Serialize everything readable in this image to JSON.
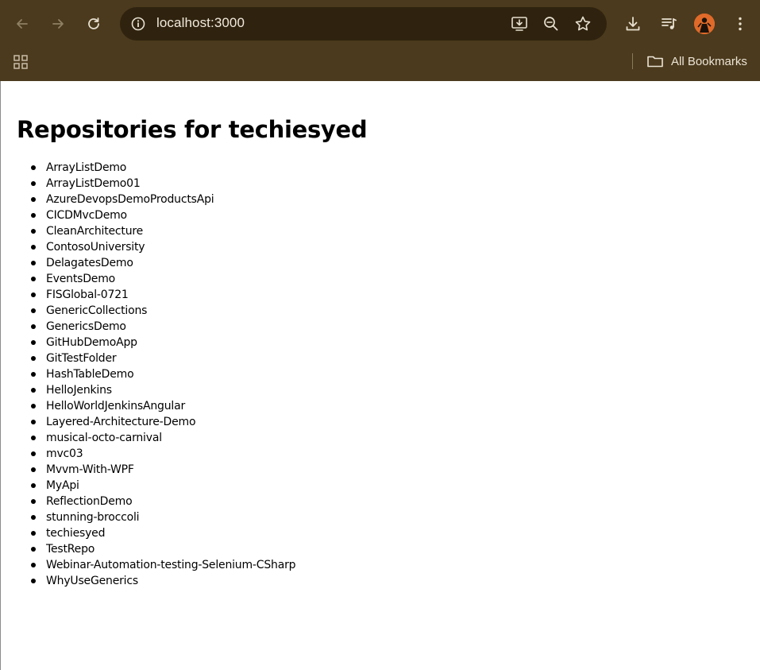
{
  "browser": {
    "url": "localhost:3000",
    "bookmarks_label": "All Bookmarks",
    "chrome_color": "#4b3a1d",
    "omnibox_color": "#2f230f",
    "icons": {
      "back": "arrow-left-icon",
      "forward": "arrow-right-icon",
      "reload": "reload-icon",
      "site_info": "info-icon",
      "install": "install-app-icon",
      "zoom": "zoom-out-icon",
      "bookmark": "star-icon",
      "download": "download-icon",
      "media": "media-controls-icon",
      "profile": "avatar",
      "menu": "kebab-menu-icon",
      "apps": "apps-grid-icon",
      "folder": "folder-icon"
    }
  },
  "page": {
    "title": "Repositories for techiesyed",
    "repositories": [
      "ArrayListDemo",
      "ArrayListDemo01",
      "AzureDevopsDemoProductsApi",
      "CICDMvcDemo",
      "CleanArchitecture",
      "ContosoUniversity",
      "DelagatesDemo",
      "EventsDemo",
      "FISGlobal-0721",
      "GenericCollections",
      "GenericsDemo",
      "GitHubDemoApp",
      "GitTestFolder",
      "HashTableDemo",
      "HelloJenkins",
      "HelloWorldJenkinsAngular",
      "Layered-Architecture-Demo",
      "musical-octo-carnival",
      "mvc03",
      "Mvvm-With-WPF",
      "MyApi",
      "ReflectionDemo",
      "stunning-broccoli",
      "techiesyed",
      "TestRepo",
      "Webinar-Automation-testing-Selenium-CSharp",
      "WhyUseGenerics"
    ]
  }
}
